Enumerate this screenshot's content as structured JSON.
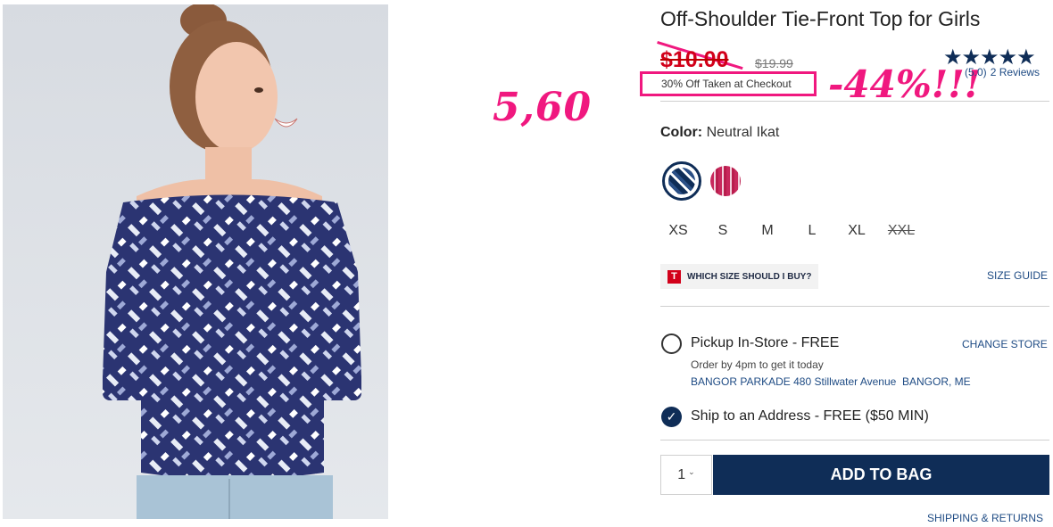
{
  "product": {
    "title": "Off-Shoulder Tie-Front Top for Girls",
    "sale_price": "$10.00",
    "original_price": "$19.99",
    "promo": "30% Off Taken at Checkout",
    "rating_value": "5.0",
    "rating_paren": "(5.0)",
    "reviews": "2 Reviews",
    "stars": "★★★★★",
    "color_label": "Color:",
    "color_value": "Neutral Ikat"
  },
  "swatches": [
    "Neutral Ikat (navy)",
    "Pink"
  ],
  "sizes": [
    {
      "label": "XS",
      "available": true
    },
    {
      "label": "S",
      "available": true
    },
    {
      "label": "M",
      "available": true
    },
    {
      "label": "L",
      "available": true
    },
    {
      "label": "XL",
      "available": true
    },
    {
      "label": "XXL",
      "available": false
    }
  ],
  "fit": {
    "icon": "T",
    "label": "WHICH SIZE SHOULD I BUY?",
    "size_guide": "SIZE GUIDE"
  },
  "fulfillment": {
    "pickup_label": "Pickup In-Store - FREE",
    "change_store": "CHANGE STORE",
    "order_note": "Order by 4pm to get it today",
    "store_address": "BANGOR PARKADE 480 Stillwater Avenue  BANGOR, ME",
    "ship_label": "Ship to an Address - FREE ($50 MIN)",
    "ship_selected": true
  },
  "purchase": {
    "quantity": "1",
    "add_to_bag": "ADD TO BAG",
    "shipping_returns": "SHIPPING & RETURNS"
  },
  "annotations": {
    "handwritten_price": "5,60",
    "discount": "-44%!!!",
    "color": "#f0187f"
  },
  "colors": {
    "navy": "#0f2d57",
    "sale_red": "#d2001a",
    "link_blue": "#1e4b84"
  }
}
